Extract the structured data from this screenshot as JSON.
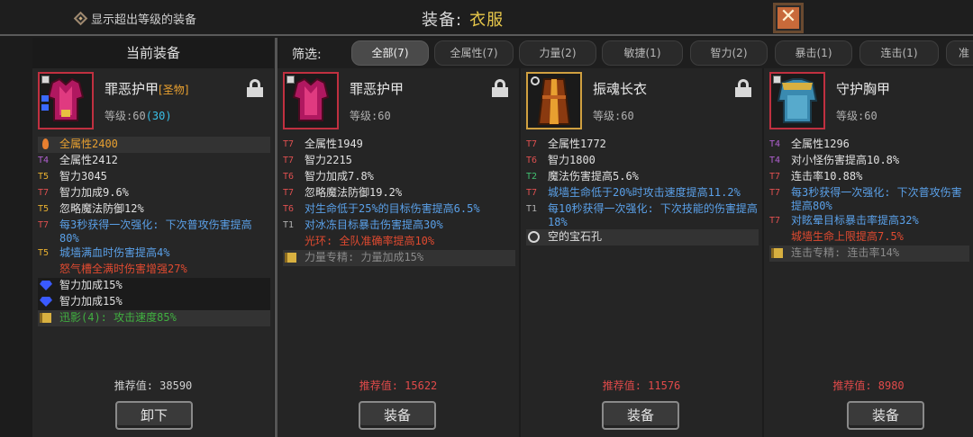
{
  "header": {
    "toggle_label": "显示超出等级的装备",
    "title_label": "装备:",
    "title_category": "衣服",
    "close_symbol": "✕"
  },
  "current": {
    "header": "当前装备",
    "name": "罪恶护甲",
    "tag": "[圣物]",
    "level_label": "等级:60",
    "level_bonus": "(30)",
    "stats": [
      {
        "tier": "",
        "text": "全属性2400",
        "color": "c-o",
        "icon": "flame-icon"
      },
      {
        "tier": "T4",
        "text": "全属性2412",
        "color": "c-w"
      },
      {
        "tier": "T5",
        "text": "智力3045",
        "color": "c-w"
      },
      {
        "tier": "T7",
        "text": "智力加成9.6%",
        "color": "c-w"
      },
      {
        "tier": "T5",
        "text": "忽略魔法防御12%",
        "color": "c-w"
      },
      {
        "tier": "T7",
        "text": "每3秒获得一次强化: 下次普攻伤害提高80%",
        "color": "c-b"
      },
      {
        "tier": "T5",
        "text": "城墙满血时伤害提高4%",
        "color": "c-b"
      },
      {
        "tier": "",
        "text": "怒气槽全满时伤害增强27%",
        "color": "c-r"
      },
      {
        "tier": "",
        "text": "智力加成15%",
        "color": "c-w",
        "icon": "sapphire-icon"
      },
      {
        "tier": "",
        "text": "智力加成15%",
        "color": "c-w",
        "icon": "sapphire-icon"
      },
      {
        "tier": "",
        "text": "迅影(4): 攻击速度85%",
        "color": "c-gr",
        "icon": "book-icon"
      }
    ],
    "rec": "推荐值: 38590",
    "button": "卸下"
  },
  "filter": {
    "label": "筛选:",
    "tabs": [
      "全部(7)",
      "全属性(7)",
      "力量(2)",
      "敏捷(1)",
      "智力(2)",
      "暴击(1)",
      "连击(1)",
      "准"
    ]
  },
  "cards": [
    {
      "name": "罪恶护甲",
      "level_label": "等级:60",
      "stats": [
        {
          "tier": "T7",
          "text": "全属性1949",
          "color": "c-w"
        },
        {
          "tier": "T7",
          "text": "智力2215",
          "color": "c-w"
        },
        {
          "tier": "T6",
          "text": "智力加成7.8%",
          "color": "c-w"
        },
        {
          "tier": "T7",
          "text": "忽略魔法防御19.2%",
          "color": "c-w"
        },
        {
          "tier": "T6",
          "text": "对生命低于25%的目标伤害提高6.5%",
          "color": "c-b"
        },
        {
          "tier": "T1",
          "text": "对冰冻目标暴击伤害提高30%",
          "color": "c-b"
        },
        {
          "tier": "",
          "text": "光环: 全队准确率提高10%",
          "color": "c-r"
        },
        {
          "tier": "",
          "text": "力量专精: 力量加成15%",
          "color": "c-g",
          "icon": "book-icon"
        }
      ],
      "rec": "推荐值: 15622",
      "button": "装备"
    },
    {
      "name": "振魂长衣",
      "level_label": "等级:60",
      "stats": [
        {
          "tier": "T7",
          "text": "全属性1772",
          "color": "c-w"
        },
        {
          "tier": "T6",
          "text": "智力1800",
          "color": "c-w"
        },
        {
          "tier": "T2",
          "text": "魔法伤害提高5.6%",
          "color": "c-w"
        },
        {
          "tier": "T7",
          "text": "城墙生命低于20%时攻击速度提高11.2%",
          "color": "c-b"
        },
        {
          "tier": "T1",
          "text": "每10秒获得一次强化: 下次技能的伤害提高18%",
          "color": "c-b"
        },
        {
          "tier": "",
          "text": "空的宝石孔",
          "color": "c-w",
          "icon": "socket-icon"
        }
      ],
      "rec": "推荐值: 11576",
      "button": "装备"
    },
    {
      "name": "守护胸甲",
      "level_label": "等级:60",
      "stats": [
        {
          "tier": "T4",
          "text": "全属性1296",
          "color": "c-w"
        },
        {
          "tier": "T4",
          "text": "对小怪伤害提高10.8%",
          "color": "c-w"
        },
        {
          "tier": "T7",
          "text": "连击率10.88%",
          "color": "c-w"
        },
        {
          "tier": "T7",
          "text": "每3秒获得一次强化: 下次普攻伤害提高80%",
          "color": "c-b"
        },
        {
          "tier": "T7",
          "text": "对眩晕目标暴击率提高32%",
          "color": "c-b"
        },
        {
          "tier": "",
          "text": "城墙生命上限提高7.5%",
          "color": "c-r"
        },
        {
          "tier": "",
          "text": "连击专精: 连击率14%",
          "color": "c-g",
          "icon": "book-icon"
        }
      ],
      "rec": "推荐值: 8980",
      "button": "装备"
    }
  ]
}
